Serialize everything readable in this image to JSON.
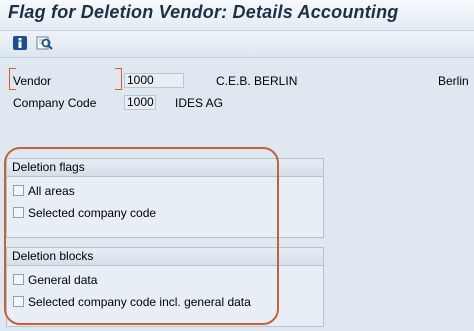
{
  "window": {
    "title": "Flag for Deletion Vendor: Details Accounting"
  },
  "toolbar": {
    "info_icon": "info-icon",
    "find_icon": "find-icon"
  },
  "header": {
    "vendor_label": "Vendor",
    "vendor_value": "1000",
    "vendor_name": "C.E.B. BERLIN",
    "vendor_city": "Berlin",
    "company_code_label": "Company Code",
    "company_code_value": "1000",
    "company_name": "IDES AG"
  },
  "deletion_flags": {
    "title": "Deletion flags",
    "items": [
      {
        "label": "All areas",
        "checked": false
      },
      {
        "label": "Selected company code",
        "checked": false
      }
    ]
  },
  "deletion_blocks": {
    "title": "Deletion blocks",
    "items": [
      {
        "label": "General data",
        "checked": false
      },
      {
        "label": "Selected company code incl. general data",
        "checked": false
      }
    ]
  },
  "colors": {
    "highlight": "#c4613c",
    "required_marker": "#e25a2c"
  }
}
